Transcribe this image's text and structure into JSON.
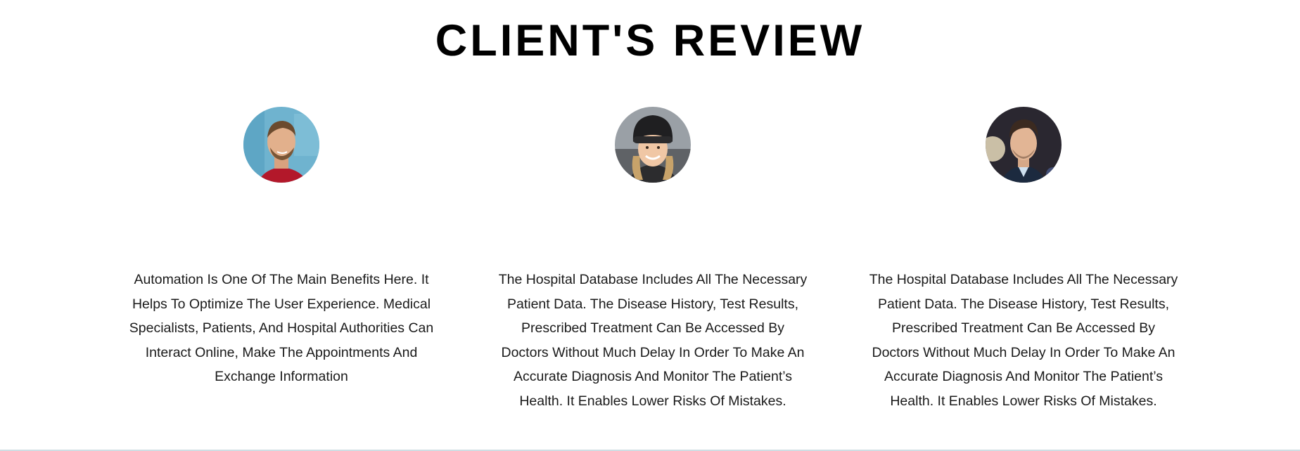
{
  "section": {
    "title": "CLIENT'S REVIEW"
  },
  "reviews": [
    {
      "avatar_icon": "bearded-man-photo",
      "text": "Automation Is One Of The Main Benefits Here. It Helps To Optimize The User Experience. Medical Specialists, Patients, And Hospital Authorities Can Interact Online, Make The Appointments And Exchange Information"
    },
    {
      "avatar_icon": "woman-beanie-photo",
      "text": "The Hospital Database Includes All The Necessary Patient Data. The Disease History, Test Results, Prescribed Treatment Can Be Accessed By Doctors Without Much Delay In Order To Make An Accurate Diagnosis And Monitor The Patient’s Health. It Enables Lower Risks Of Mistakes."
    },
    {
      "avatar_icon": "man-dark-background-photo",
      "text": "The Hospital Database Includes All The Necessary Patient Data. The Disease History, Test Results, Prescribed Treatment Can Be Accessed By Doctors Without Much Delay In Order To Make An Accurate Diagnosis And Monitor The Patient’s Health. It Enables Lower Risks Of Mistakes."
    }
  ],
  "colors": {
    "title": "#000000",
    "text": "#1a1a1a",
    "background": "#ffffff",
    "divider": "#cfdde3"
  }
}
